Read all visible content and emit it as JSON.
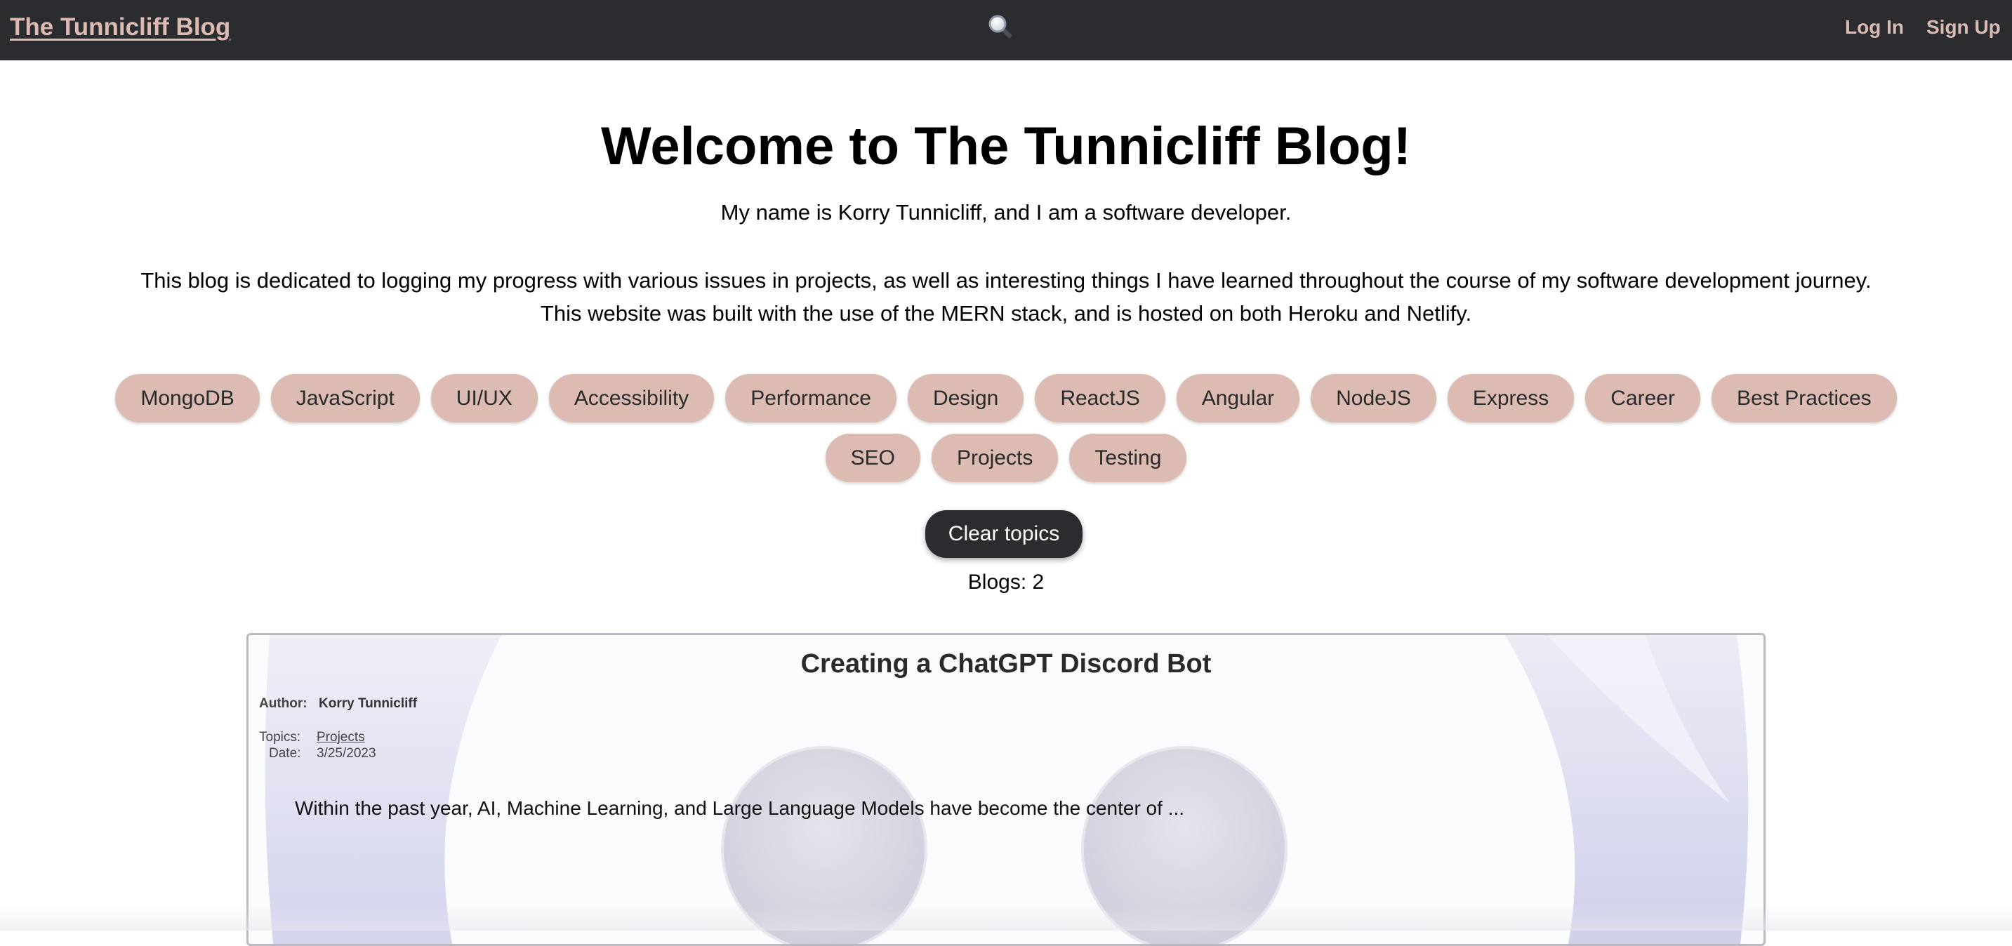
{
  "nav": {
    "brand": "The Tunnicliff Blog",
    "search_icon": "magnifying-glass",
    "login": "Log In",
    "signup": "Sign Up"
  },
  "hero": {
    "title": "Welcome to The Tunnicliff Blog!",
    "subtitle": "My name is Korry Tunnicliff, and I am a software developer.",
    "description": "This blog is dedicated to logging my progress with various issues in projects, as well as interesting things I have learned throughout the course of my software development journey. This website was built with the use of the MERN stack, and is hosted on both Heroku and Netlify."
  },
  "topics": [
    "MongoDB",
    "JavaScript",
    "UI/UX",
    "Accessibility",
    "Performance",
    "Design",
    "ReactJS",
    "Angular",
    "NodeJS",
    "Express",
    "Career",
    "Best Practices",
    "SEO",
    "Projects",
    "Testing"
  ],
  "clear_topics": "Clear topics",
  "blog_count": "Blogs: 2",
  "blogs": [
    {
      "title": "Creating a ChatGPT Discord Bot",
      "author_label": "Author:",
      "author": "Korry Tunnicliff",
      "topics_label": "Topics:",
      "topics": "Projects",
      "date_label": "Date:",
      "date": "3/25/2023",
      "excerpt": "Within the past year, AI, Machine Learning, and Large Language Models have become the center of ..."
    }
  ],
  "colors": {
    "nav_bg": "#2b2c30",
    "accent": "#dcbbb3",
    "chip_bg": "#dcbbb3",
    "button_dark": "#2b2c30"
  }
}
